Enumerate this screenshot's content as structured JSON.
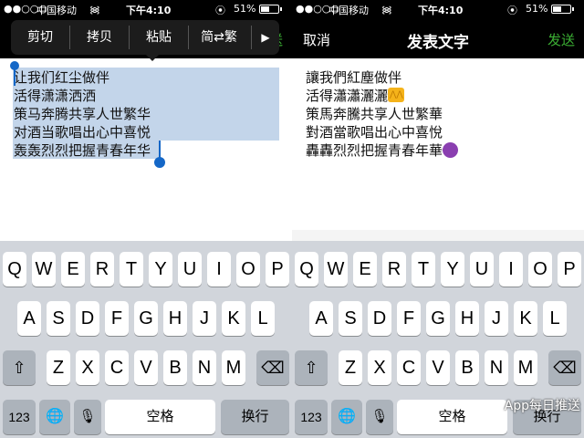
{
  "status": {
    "signal": "●●○○○",
    "carrier": "中国移动",
    "wifi": "᯼",
    "time": "下午4:10",
    "lock": "⦿",
    "battery": "51%",
    "battery_level": 0.51
  },
  "nav": {
    "cancel": "取消",
    "title": "发表文字",
    "send": "发送"
  },
  "edit_menu": {
    "items": [
      "剪切",
      "拷贝",
      "粘贴",
      "简⇄繁"
    ],
    "more": "▶"
  },
  "left_text": [
    "让我们红尘做伴",
    "活得潇潇洒洒",
    "策马奔腾共享人世繁华",
    "对酒当歌唱出心中喜悦",
    "轰轰烈烈把握青春年华"
  ],
  "right_text": [
    "讓我們紅塵做伴",
    "活得瀟瀟灑灑",
    "策馬奔騰共享人世繁華",
    "對酒當歌唱出心中喜悅",
    "轟轟烈烈把握青春年華"
  ],
  "keyboard": {
    "row1": [
      "Q",
      "W",
      "E",
      "R",
      "T",
      "Y",
      "U",
      "I",
      "O",
      "P"
    ],
    "row2": [
      "A",
      "S",
      "D",
      "F",
      "G",
      "H",
      "J",
      "K",
      "L"
    ],
    "row3": [
      "Z",
      "X",
      "C",
      "V",
      "B",
      "N",
      "M"
    ],
    "shift_icon": "⇧",
    "delete_icon": "⌫",
    "numbers": "123",
    "globe_icon": "🌐",
    "mic_icon": "🎙",
    "space": "空格",
    "return": "换行"
  },
  "watermark": "App每日推送"
}
